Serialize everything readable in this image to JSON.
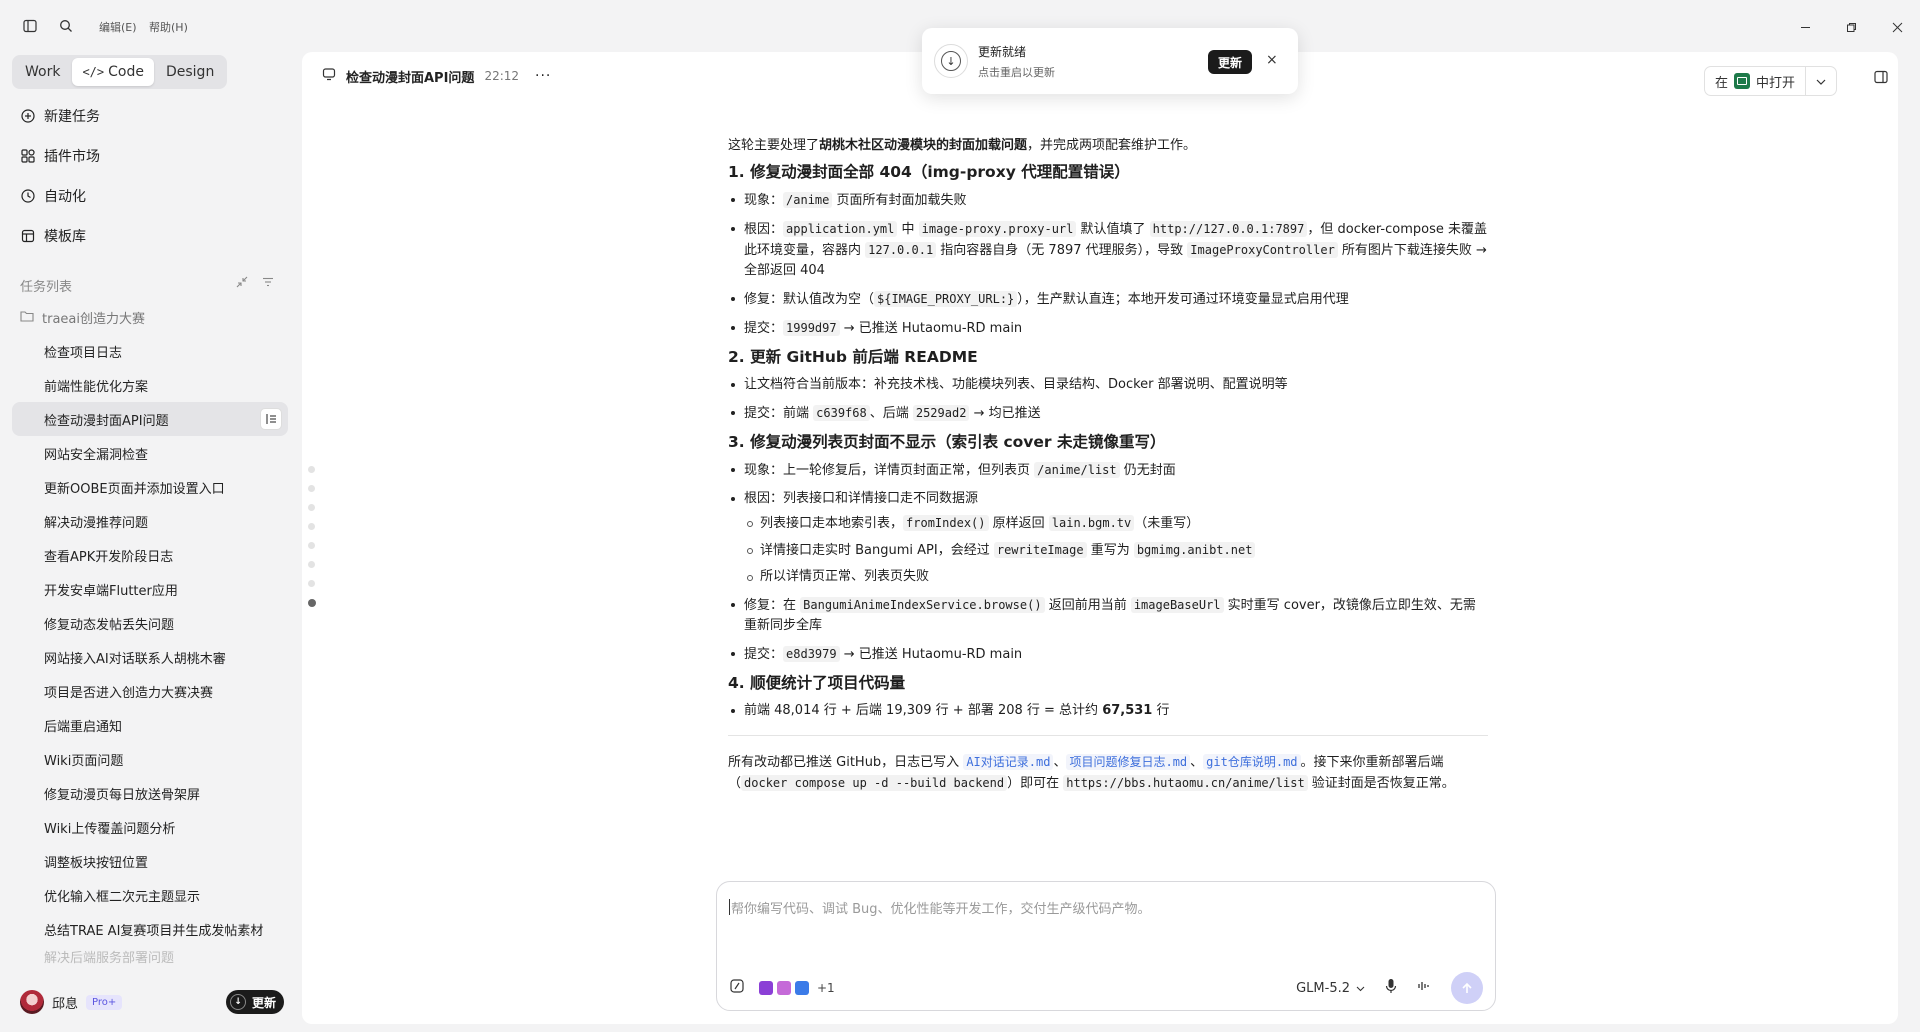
{
  "titlebar": {
    "menu_edit": "编辑(E)",
    "menu_help": "帮助(H)"
  },
  "sidebar": {
    "modes": [
      "Work",
      "Code",
      "Design"
    ],
    "active_mode": "Code",
    "nav": [
      {
        "label": "新建任务",
        "icon": "plus-circle-icon"
      },
      {
        "label": "插件市场",
        "icon": "plugins-icon"
      },
      {
        "label": "自动化",
        "icon": "clock-icon"
      },
      {
        "label": "模板库",
        "icon": "template-icon"
      }
    ],
    "section_label": "任务列表",
    "folder": "traeai创造力大赛",
    "tasks": [
      "检查项目日志",
      "前端性能优化方案",
      "检查动漫封面API问题",
      "网站安全漏洞检查",
      "更新OOBE页面并添加设置入口",
      "解决动漫推荐问题",
      "查看APK开发阶段日志",
      "开发安卓端Flutter应用",
      "修复动态发帖丢失问题",
      "网站接入AI对话联系人胡桃木審",
      "项目是否进入创造力大赛决赛",
      "后端重启通知",
      "Wiki页面问题",
      "修复动漫页每日放送骨架屏",
      "Wiki上传覆盖问题分析",
      "调整板块按钮位置",
      "优化输入框二次元主题显示",
      "总结TRAE AI复赛项目并生成发帖素材",
      "解决后端服务部署问题"
    ],
    "active_task_index": 2,
    "user": {
      "name": "邱息",
      "badge": "Pro+"
    },
    "update_label": "更新"
  },
  "main": {
    "title": "检查动漫封面API问题",
    "time": "22:12",
    "open_in_prefix": "在",
    "open_in_label": "中打开"
  },
  "toast": {
    "title": "更新就绪",
    "subtitle": "点击重启以更新",
    "button": "更新",
    "close": "×"
  },
  "message": {
    "intro_a": "这轮主要处理了",
    "intro_bold": "胡桃木社区动漫模块的封面加载问题",
    "intro_b": "，并完成两项配套维护工作。",
    "s1_title": "1. 修复动漫封面全部 404（img-proxy 代理配置错误）",
    "s1_b1_a": "现象：",
    "s1_b1_code": "/anime",
    "s1_b1_b": " 页面所有封面加载失败",
    "s1_b2_a": "根因：",
    "s1_b2_code1": "application.yml",
    "s1_b2_b": " 中 ",
    "s1_b2_code2": "image-proxy.proxy-url",
    "s1_b2_c": " 默认值填了 ",
    "s1_b2_code3": "http://127.0.0.1:7897",
    "s1_b2_d": "，但 docker-compose 未覆盖此环境变量，容器内 ",
    "s1_b2_code4": "127.0.0.1",
    "s1_b2_e": " 指向容器自身（无 7897 代理服务），导致 ",
    "s1_b2_code5": "ImageProxyController",
    "s1_b2_f": " 所有图片下载连接失败 → 全部返回 404",
    "s1_b3_a": "修复：默认值改为空（",
    "s1_b3_code": "${IMAGE_PROXY_URL:}",
    "s1_b3_b": "），生产默认直连；本地开发可通过环境变量显式启用代理",
    "s1_b4_a": "提交：",
    "s1_b4_code": "1999d97",
    "s1_b4_b": " → 已推送 Hutaomu-RD main",
    "s2_title": "2. 更新 GitHub 前后端 README",
    "s2_b1": "让文档符合当前版本：补充技术栈、功能模块列表、目录结构、Docker 部署说明、配置说明等",
    "s2_b2_a": "提交：前端 ",
    "s2_b2_code1": "c639f68",
    "s2_b2_b": "、后端 ",
    "s2_b2_code2": "2529ad2",
    "s2_b2_c": " → 均已推送",
    "s3_title": "3. 修复动漫列表页封面不显示（索引表 cover 未走镜像重写）",
    "s3_b1_a": "现象：上一轮修复后，详情页封面正常，但列表页 ",
    "s3_b1_code": "/anime/list",
    "s3_b1_b": " 仍无封面",
    "s3_b2": "根因：列表接口和详情接口走不同数据源",
    "s3_sub1_a": "列表接口走本地索引表，",
    "s3_sub1_code1": "fromIndex()",
    "s3_sub1_b": " 原样返回 ",
    "s3_sub1_code2": "lain.bgm.tv",
    "s3_sub1_c": "（未重写）",
    "s3_sub2_a": "详情接口走实时 Bangumi API，会经过 ",
    "s3_sub2_code1": "rewriteImage",
    "s3_sub2_b": " 重写为 ",
    "s3_sub2_code2": "bgmimg.anibt.net",
    "s3_sub3": "所以详情页正常、列表页失败",
    "s3_b3_a": "修复：在 ",
    "s3_b3_code1": "BangumiAnimeIndexService.browse()",
    "s3_b3_b": " 返回前用当前 ",
    "s3_b3_code2": "imageBaseUrl",
    "s3_b3_c": " 实时重写 cover，改镜像后立即生效、无需重新同步全库",
    "s3_b4_a": "提交：",
    "s3_b4_code": "e8d3979",
    "s3_b4_b": " → 已推送 Hutaomu-RD main",
    "s4_title": "4. 顺便统计了项目代码量",
    "s4_b1_a": "前端 48,014 行 + 后端 19,309 行 + 部署 208 行 = 总计约 ",
    "s4_b1_bold": "67,531",
    "s4_b1_b": " 行",
    "outro_a": "所有改动都已推送 GitHub，日志已写入 ",
    "outro_link1": "AI对话记录.md",
    "outro_sep1": "、",
    "outro_link2": "项目问题修复日志.md",
    "outro_sep2": "、",
    "outro_link3": "git仓库说明.md",
    "outro_b": "。接下来你重新部署后端（",
    "outro_code1": "docker compose up -d --build backend",
    "outro_c": "）即可在 ",
    "outro_code2": "https://bbs.hutaomu.cn/anime/list",
    "outro_d": " 验证封面是否恢复正常。"
  },
  "composer": {
    "placeholder": "帮你编写代码、调试 Bug、优化性能等开发工作，交付生产级代码产物。",
    "extra_count": "+1",
    "model": "GLM-5.2"
  }
}
